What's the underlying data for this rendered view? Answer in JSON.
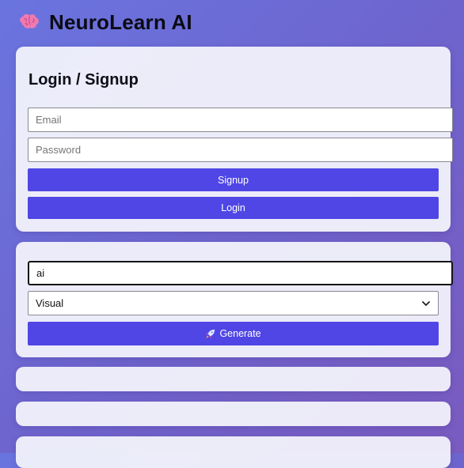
{
  "header": {
    "title": "NeuroLearn AI",
    "logo_icon": "brain-icon"
  },
  "auth": {
    "title": "Login / Signup",
    "email_placeholder": "Email",
    "password_placeholder": "Password",
    "signup_label": "Signup",
    "login_label": "Login"
  },
  "generator": {
    "topic_value": "ai",
    "style_selected": "Visual",
    "generate_label": "Generate",
    "generate_icon": "rocket-icon"
  },
  "colors": {
    "accent": "#4f46e5",
    "brain": "#f07ab0"
  }
}
